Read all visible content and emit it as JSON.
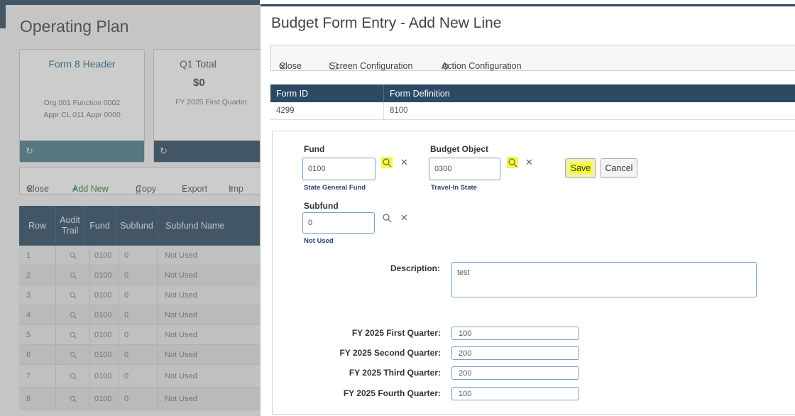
{
  "background": {
    "title": "Operating Plan",
    "cards": [
      {
        "title": "Form 8 Header",
        "amount": "",
        "lines": [
          "Org 001 Function 0002",
          "Appr CL 011 Appr 0000"
        ]
      },
      {
        "title": "Q1 Total",
        "amount": "$0",
        "lines": [
          "FY 2025 First Quarter"
        ]
      }
    ],
    "toolbar": {
      "close": "Close",
      "add_new": "Add New",
      "copy": "Copy",
      "export": "Export",
      "import": "Imp"
    },
    "grid": {
      "headers": [
        "Row",
        "Audit Trail",
        "Fund",
        "Subfund",
        "Subfund Name"
      ],
      "rows": [
        {
          "row": "1",
          "fund": "0100",
          "subfund": "0",
          "name": "Not Used"
        },
        {
          "row": "2",
          "fund": "0100",
          "subfund": "0",
          "name": "Not Used"
        },
        {
          "row": "3",
          "fund": "0100",
          "subfund": "0",
          "name": "Not Used"
        },
        {
          "row": "4",
          "fund": "0100",
          "subfund": "0",
          "name": "Not Used"
        },
        {
          "row": "5",
          "fund": "0100",
          "subfund": "0",
          "name": "Not Used"
        },
        {
          "row": "6",
          "fund": "0100",
          "subfund": "0",
          "name": "Not Used"
        },
        {
          "row": "7",
          "fund": "0100",
          "subfund": "0",
          "name": "Not Used"
        },
        {
          "row": "8",
          "fund": "0100",
          "subfund": "0",
          "name": "Not Used"
        }
      ]
    }
  },
  "dialog": {
    "title": "Budget Form Entry - Add New Line",
    "toolbar": {
      "close": "Close",
      "screen_config": "Screen Configuration",
      "action_config": "Action Configuration"
    },
    "form_table": {
      "headers": [
        "Form ID",
        "Form Definition"
      ],
      "row": [
        "4299",
        "8100"
      ]
    },
    "fund": {
      "label": "Fund",
      "value": "0100",
      "desc": "State General Fund"
    },
    "budget_object": {
      "label": "Budget Object",
      "value": "0300",
      "desc": "Travel-In State"
    },
    "subfund": {
      "label": "Subfund",
      "value": "0",
      "desc": "Not Used"
    },
    "buttons": {
      "save": "Save",
      "cancel": "Cancel"
    },
    "description": {
      "label": "Description:",
      "value": "test"
    },
    "quarters": [
      {
        "label": "FY 2025 First Quarter:",
        "value": "100"
      },
      {
        "label": "FY 2025 Second Quarter:",
        "value": "200"
      },
      {
        "label": "FY 2025 Third Quarter:",
        "value": "200"
      },
      {
        "label": "FY 2025 Fourth Quarter:",
        "value": "100"
      }
    ]
  },
  "colors": {
    "header_navy": "#2c4a63",
    "highlight": "#f4ff3a",
    "add_new_green": "#2f7a37"
  }
}
